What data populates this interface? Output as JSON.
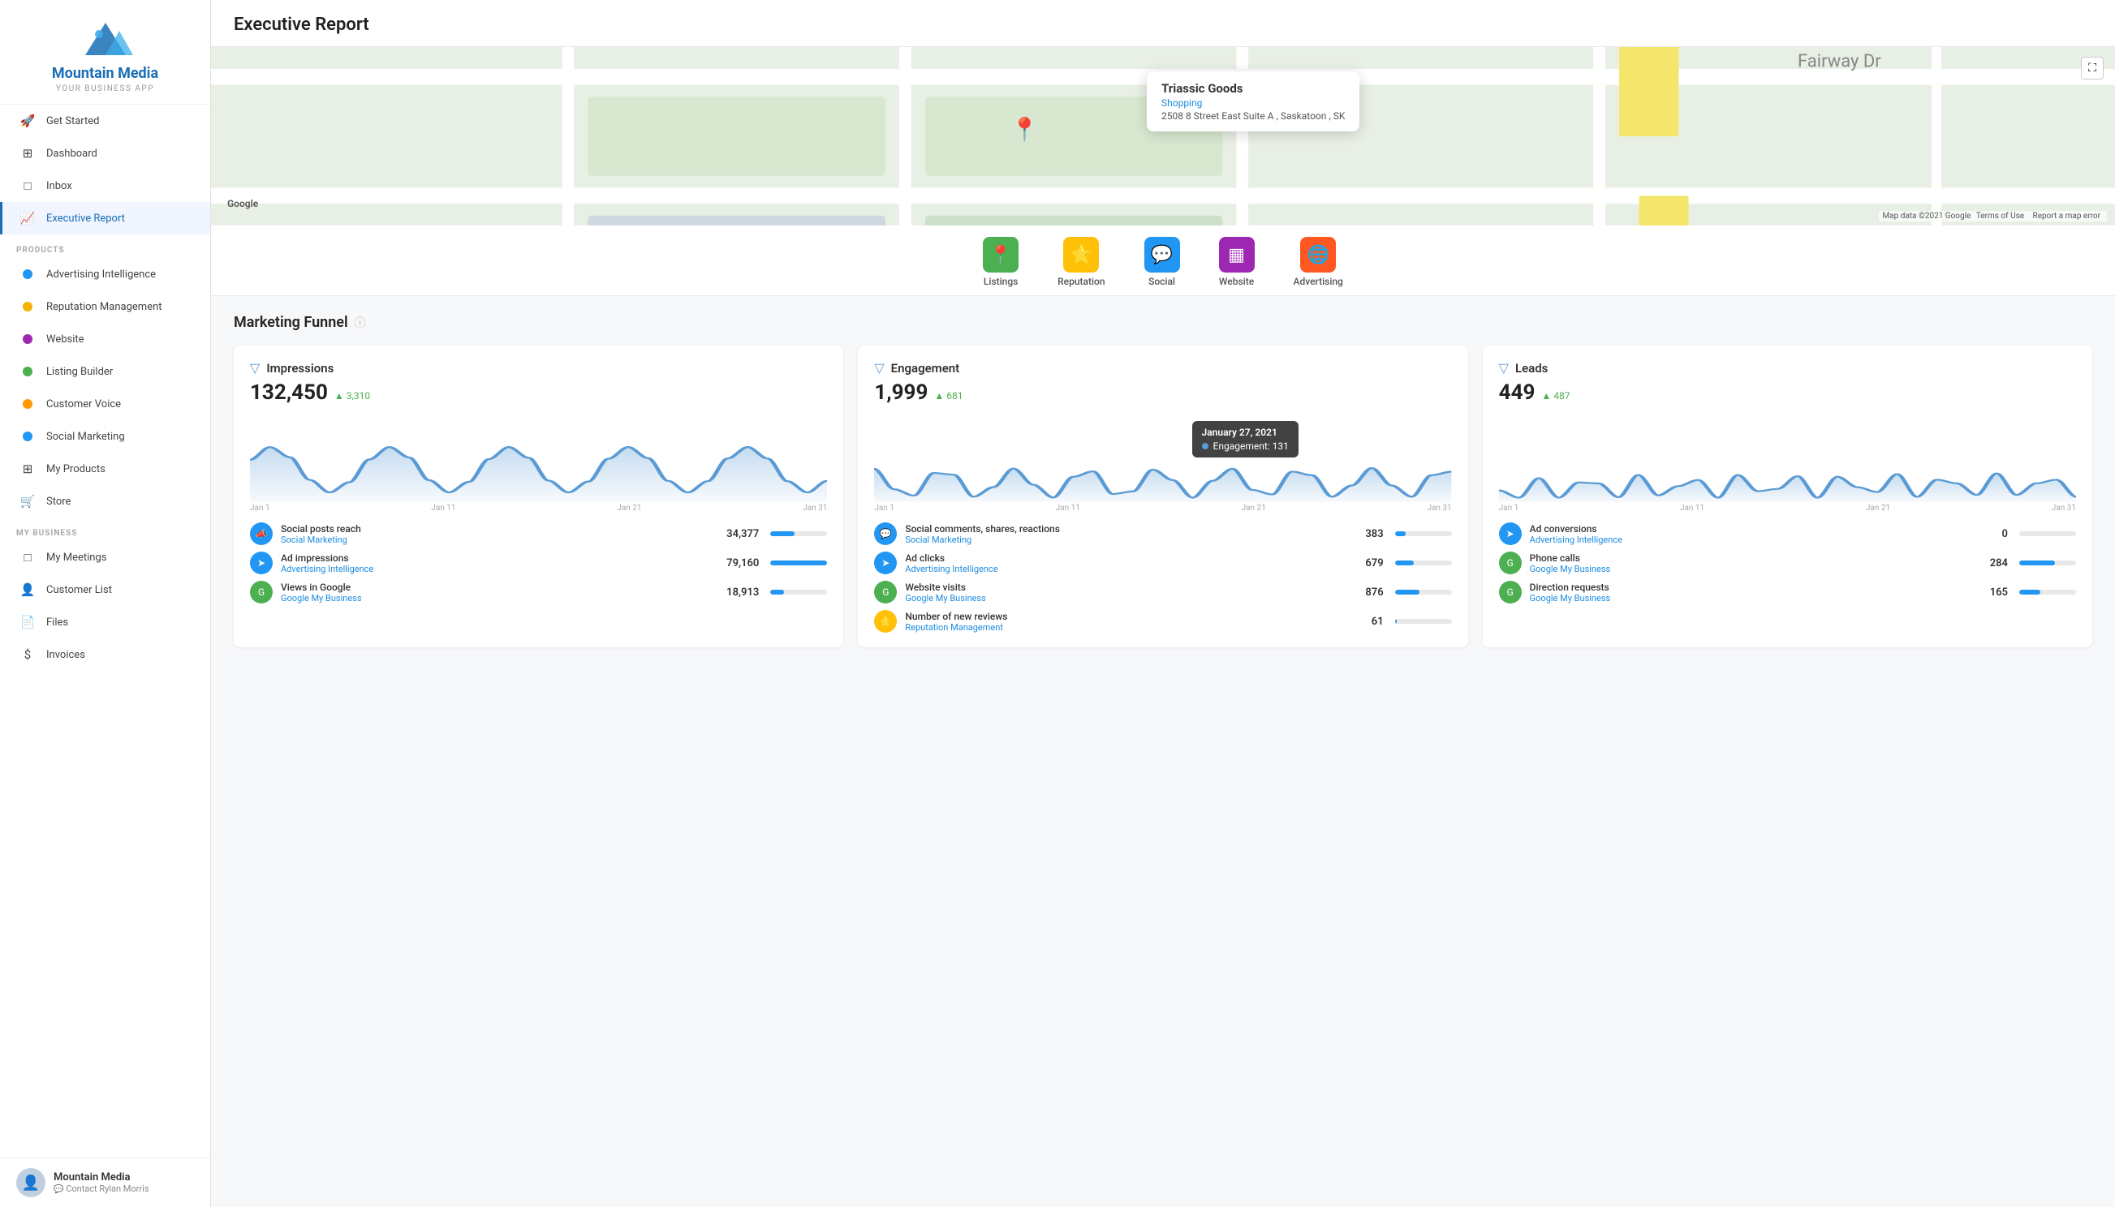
{
  "sidebar": {
    "brand": {
      "name": "Mountain Media",
      "sub": "YOUR BUSINESS APP"
    },
    "nav_items": [
      {
        "id": "get-started",
        "label": "Get Started",
        "icon": "🚀"
      },
      {
        "id": "dashboard",
        "label": "Dashboard",
        "icon": "⊞"
      },
      {
        "id": "inbox",
        "label": "Inbox",
        "icon": "□"
      },
      {
        "id": "executive-report",
        "label": "Executive Report",
        "icon": "📈",
        "active": true
      }
    ],
    "section_products": "PRODUCTS",
    "products": [
      {
        "id": "advertising-intelligence",
        "label": "Advertising Intelligence",
        "icon": "◎",
        "color": "#2196f3"
      },
      {
        "id": "reputation-management",
        "label": "Reputation Management",
        "icon": "●",
        "color": "#f4b400"
      },
      {
        "id": "website",
        "label": "Website",
        "icon": "◈",
        "color": "#9c27b0"
      },
      {
        "id": "listing-builder",
        "label": "Listing Builder",
        "icon": "●",
        "color": "#4caf50"
      },
      {
        "id": "customer-voice",
        "label": "Customer Voice",
        "icon": "●",
        "color": "#ff9800"
      },
      {
        "id": "social-marketing",
        "label": "Social Marketing",
        "icon": "●",
        "color": "#2196f3"
      },
      {
        "id": "my-products",
        "label": "My Products",
        "icon": "⊞",
        "color": "#555"
      },
      {
        "id": "store",
        "label": "Store",
        "icon": "🛒",
        "color": "#555"
      }
    ],
    "section_my_business": "MY BUSINESS",
    "my_business": [
      {
        "id": "my-meetings",
        "label": "My Meetings",
        "icon": "□"
      },
      {
        "id": "customer-list",
        "label": "Customer List",
        "icon": "👤"
      },
      {
        "id": "files",
        "label": "Files",
        "icon": "📄"
      },
      {
        "id": "invoices",
        "label": "Invoices",
        "icon": "$"
      }
    ],
    "user": {
      "name": "Mountain Media",
      "sub": "Contact Rylan Morris"
    }
  },
  "header": {
    "title": "Executive Report"
  },
  "map": {
    "business_name": "Triassic Goods",
    "business_category": "Shopping",
    "business_address": "2508 8 Street East Suite A , Saskatoon , SK",
    "attribution": "Map data ©2021 Google",
    "terms": "Terms of Use",
    "report_error": "Report a map error",
    "google_label": "Google"
  },
  "nav_icons": [
    {
      "id": "listings",
      "label": "Listings",
      "icon": "📍",
      "color_class": "nic-green"
    },
    {
      "id": "reputation",
      "label": "Reputation",
      "icon": "⭐",
      "color_class": "nic-yellow"
    },
    {
      "id": "social",
      "label": "Social",
      "icon": "💬",
      "color_class": "nic-blue"
    },
    {
      "id": "website",
      "label": "Website",
      "icon": "▦",
      "color_class": "nic-purple"
    },
    {
      "id": "advertising",
      "label": "Advertising",
      "icon": "🌐",
      "color_class": "nic-orange"
    }
  ],
  "funnel": {
    "title": "Marketing Funnel",
    "columns": [
      {
        "id": "impressions",
        "title": "Impressions",
        "value": "132,450",
        "delta": "3,310",
        "chart_max": 20000,
        "chart_labels": [
          "Jan 1",
          "Jan 11",
          "Jan 21",
          "Jan 31"
        ],
        "rows": [
          {
            "label": "Social posts reach",
            "sub": "Social Marketing",
            "value": "34,377",
            "bar_pct": 43,
            "icon": "📣",
            "icon_bg": "#2196f3"
          },
          {
            "label": "Ad impressions",
            "sub": "Advertising Intelligence",
            "value": "79,160",
            "bar_pct": 99,
            "icon": "➤",
            "icon_bg": "#2196f3"
          },
          {
            "label": "Views in Google",
            "sub": "Google My Business",
            "value": "18,913",
            "bar_pct": 24,
            "icon": "G",
            "icon_bg": "#4caf50"
          }
        ]
      },
      {
        "id": "engagement",
        "title": "Engagement",
        "value": "1,999",
        "delta": "681",
        "chart_max": 200,
        "chart_labels": [
          "Jan 1",
          "Jan 11",
          "Jan 21",
          "Jan 31"
        ],
        "tooltip": {
          "date": "January 27, 2021",
          "label": "Engagement",
          "value": "131"
        },
        "rows": [
          {
            "label": "Social comments, shares, reactions",
            "sub": "Social Marketing",
            "value": "383",
            "bar_pct": 19,
            "icon": "💬",
            "icon_bg": "#2196f3"
          },
          {
            "label": "Ad clicks",
            "sub": "Advertising Intelligence",
            "value": "679",
            "bar_pct": 34,
            "icon": "➤",
            "icon_bg": "#2196f3"
          },
          {
            "label": "Website visits",
            "sub": "Google My Business",
            "value": "876",
            "bar_pct": 44,
            "icon": "G",
            "icon_bg": "#4caf50"
          },
          {
            "label": "Number of new reviews",
            "sub": "Reputation Management",
            "value": "61",
            "bar_pct": 3,
            "icon": "⭐",
            "icon_bg": "#ffc107"
          }
        ]
      },
      {
        "id": "leads",
        "title": "Leads",
        "value": "449",
        "delta": "487",
        "chart_max": 40,
        "chart_labels": [
          "Jan 1",
          "Jan 11",
          "Jan 21",
          "Jan 31"
        ],
        "rows": [
          {
            "label": "Ad conversions",
            "sub": "Advertising Intelligence",
            "value": "0",
            "bar_pct": 0,
            "icon": "➤",
            "icon_bg": "#2196f3"
          },
          {
            "label": "Phone calls",
            "sub": "Google My Business",
            "value": "284",
            "bar_pct": 63,
            "icon": "G",
            "icon_bg": "#4caf50"
          },
          {
            "label": "Direction requests",
            "sub": "Google My Business",
            "value": "165",
            "bar_pct": 37,
            "icon": "G",
            "icon_bg": "#4caf50"
          }
        ]
      }
    ]
  }
}
